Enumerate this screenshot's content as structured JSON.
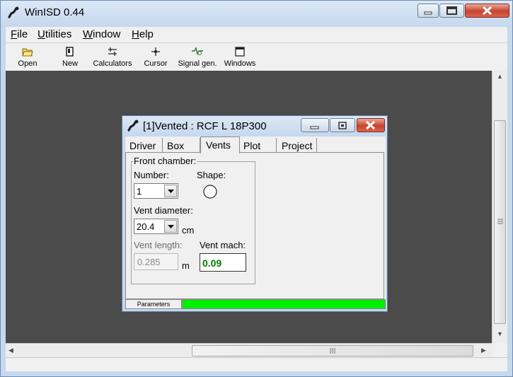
{
  "app": {
    "title": "WinISD 0.44"
  },
  "menu": {
    "file": {
      "key": "F",
      "rest": "ile"
    },
    "utilities": {
      "key": "U",
      "rest": "tilities"
    },
    "window": {
      "key": "W",
      "rest": "indow"
    },
    "help": {
      "key": "H",
      "rest": "elp"
    }
  },
  "toolbar": {
    "open": "Open",
    "new": "New",
    "calculators": "Calculators",
    "cursor": "Cursor",
    "signal_gen": "Signal gen.",
    "windows": "Windows"
  },
  "child": {
    "title": "[1]Vented : RCF L 18P300",
    "tabs": [
      "Driver",
      "Box",
      "Vents",
      "Plot",
      "Project"
    ],
    "active_tab": "Vents",
    "front_chamber": "Front chamber:",
    "number_label": "Number:",
    "number_value": "1",
    "shape_label": "Shape:",
    "shape": "circle",
    "vent_diameter_label": "Vent diameter:",
    "vent_diameter_value": "20.4",
    "vent_diameter_unit": "cm",
    "vent_length_label": "Vent length:",
    "vent_length_value": "0.285",
    "vent_length_unit": "m",
    "vent_mach_label": "Vent mach:",
    "vent_mach_value": "0.09",
    "vent_mach_color": "#007a00",
    "parameters_label": "Parameters",
    "parameters_progress": 1.0,
    "progress_color": "#00ee00"
  }
}
